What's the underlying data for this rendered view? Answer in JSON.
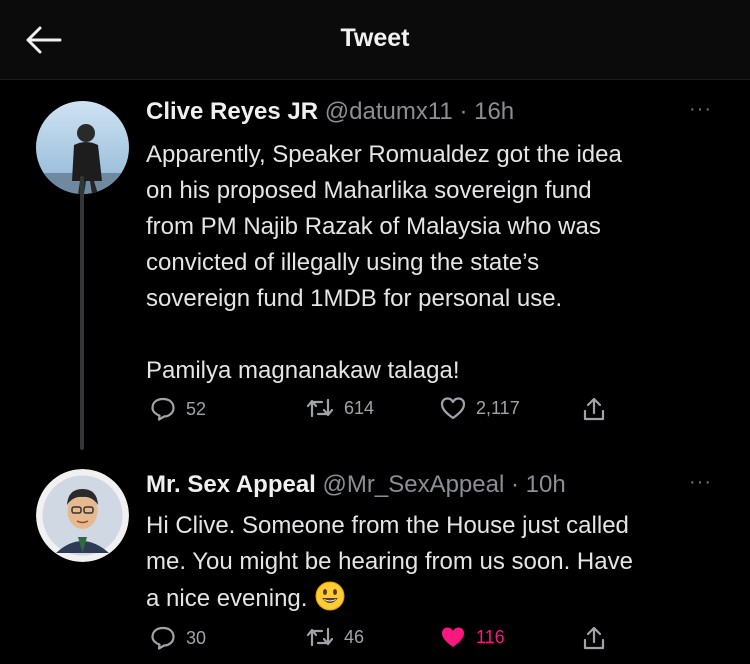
{
  "header": {
    "title": "Tweet",
    "back_icon": "arrow-left-icon"
  },
  "tweets": [
    {
      "name": "Clive Reyes JR",
      "handle": "@datumx11",
      "time": "· 16h",
      "more": "···",
      "lines": [
        "Apparently, Speaker Romualdez got the idea",
        "on his proposed Maharlika sovereign fund",
        "from PM Najib Razak of Malaysia who was",
        "convicted of illegally using the state’s",
        "sovereign fund 1MDB for personal use.",
        "",
        "Pamilya magnanakaw talaga!"
      ],
      "replies": "52",
      "retweets": "614",
      "likes": "2,117",
      "liked": false
    },
    {
      "name": "Mr. Sex Appeal",
      "handle": "@Mr_SexAppeal",
      "time": "· 10h",
      "more": "···",
      "lines": [
        "Hi Clive. Someone from the House just called",
        "me. You might be hearing from us soon. Have",
        "a nice evening."
      ],
      "replies": "30",
      "retweets": "46",
      "likes": "116",
      "liked": true,
      "like_color": "#f91880"
    }
  ]
}
